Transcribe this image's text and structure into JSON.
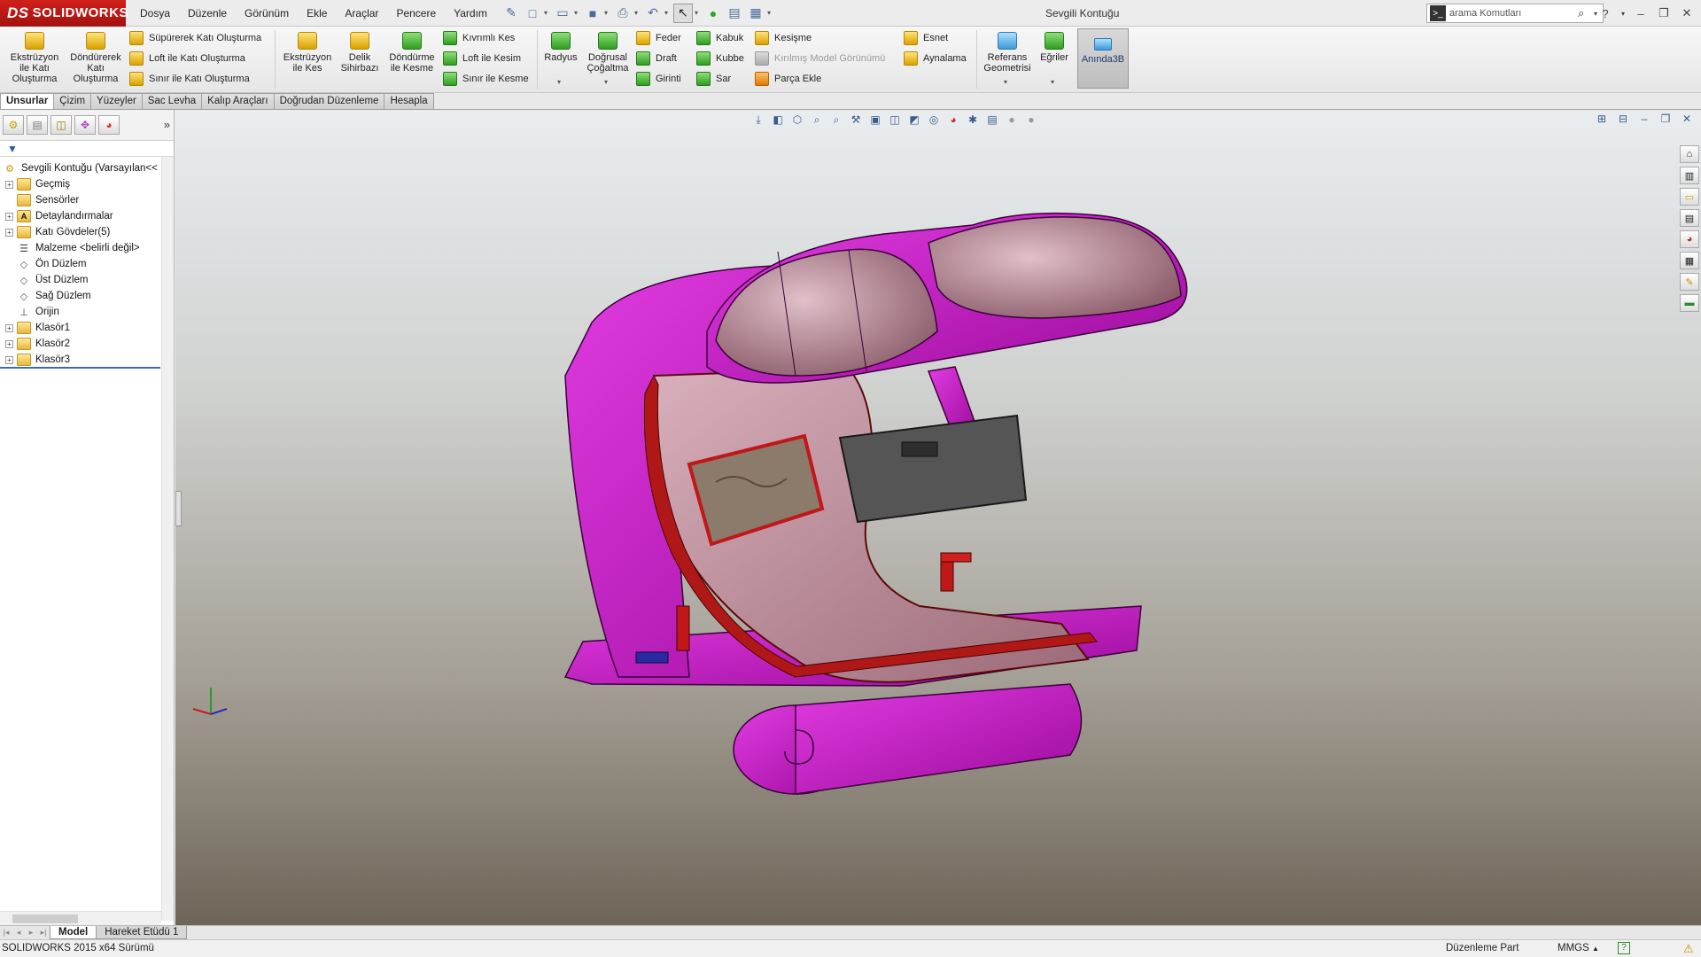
{
  "app": {
    "logo": "SOLIDWORKS",
    "logo_mark": "DS"
  },
  "menu": [
    "Dosya",
    "Düzenle",
    "Görünüm",
    "Ekle",
    "Araçlar",
    "Pencere",
    "Yardım"
  ],
  "document_title": "Sevgili Kontuğu",
  "search": {
    "placeholder": "arama Komutları"
  },
  "command_manager": {
    "extrude_boss": "Ekstrüzyon ile Katı Oluşturma",
    "revolve_boss": "Döndürerek Katı Oluşturma",
    "sweep_boss": "Süpürerek Katı Oluşturma",
    "loft_boss": "Loft ile Katı Oluşturma",
    "boundary_boss": "Sınır ile Katı Oluşturma",
    "extrude_cut": "Ekstrüzyon ile Kes",
    "hole_wizard": "Delik Sihirbazı",
    "revolve_cut": "Döndürme ile Kesme",
    "swept_cut": "Kıvrımlı Kes",
    "loft_cut": "Loft ile Kesim",
    "boundary_cut": "Sınır ile Kesme",
    "fillet": "Radyus",
    "linear_pattern": "Doğrusal Çoğaltma",
    "rib": "Feder",
    "draft": "Draft",
    "indent": "Girinti",
    "shell": "Kabuk",
    "dome": "Kubbe",
    "wrap": "Sar",
    "intersect": "Kesişme",
    "exploded_view": "Kırılmış Model Görünümü",
    "insert_part": "Parça Ekle",
    "flex": "Esnet",
    "mirror": "Aynalama",
    "ref_geometry": "Referans Geometrisi",
    "curves": "Eğriler",
    "instant3d": "Anında3B"
  },
  "tabs": [
    "Unsurlar",
    "Çizim",
    "Yüzeyler",
    "Sac Levha",
    "Kalıp Araçları",
    "Doğrudan Düzenleme",
    "Hesapla"
  ],
  "active_tab": "Unsurlar",
  "feature_tree": {
    "root": "Sevgili Kontuğu  (Varsayılan<<",
    "items": [
      {
        "label": "Geçmiş",
        "expandable": true
      },
      {
        "label": "Sensörler",
        "expandable": false
      },
      {
        "label": "Detaylandırmalar",
        "expandable": true
      },
      {
        "label": "Katı Gövdeler(5)",
        "expandable": true
      },
      {
        "label": "Malzeme <belirli değil>",
        "expandable": false
      },
      {
        "label": "Ön Düzlem",
        "expandable": false
      },
      {
        "label": "Üst Düzlem",
        "expandable": false
      },
      {
        "label": "Sağ Düzlem",
        "expandable": false
      },
      {
        "label": "Orijin",
        "expandable": false
      },
      {
        "label": "Klasör1",
        "expandable": true
      },
      {
        "label": "Klasör2",
        "expandable": true
      },
      {
        "label": "Klasör3",
        "expandable": true
      }
    ]
  },
  "bottom_tabs": [
    "Model",
    "Hareket Etüdü 1"
  ],
  "status": {
    "version": "SOLIDWORKS 2015 x64 Sürümü",
    "mode": "Düzenleme Part",
    "units": "MMGS",
    "units_arrow": "▲"
  },
  "colors": {
    "model_magenta": "#cc11cc",
    "fabric": "#c79aa8",
    "accent_red": "#c8181a"
  }
}
